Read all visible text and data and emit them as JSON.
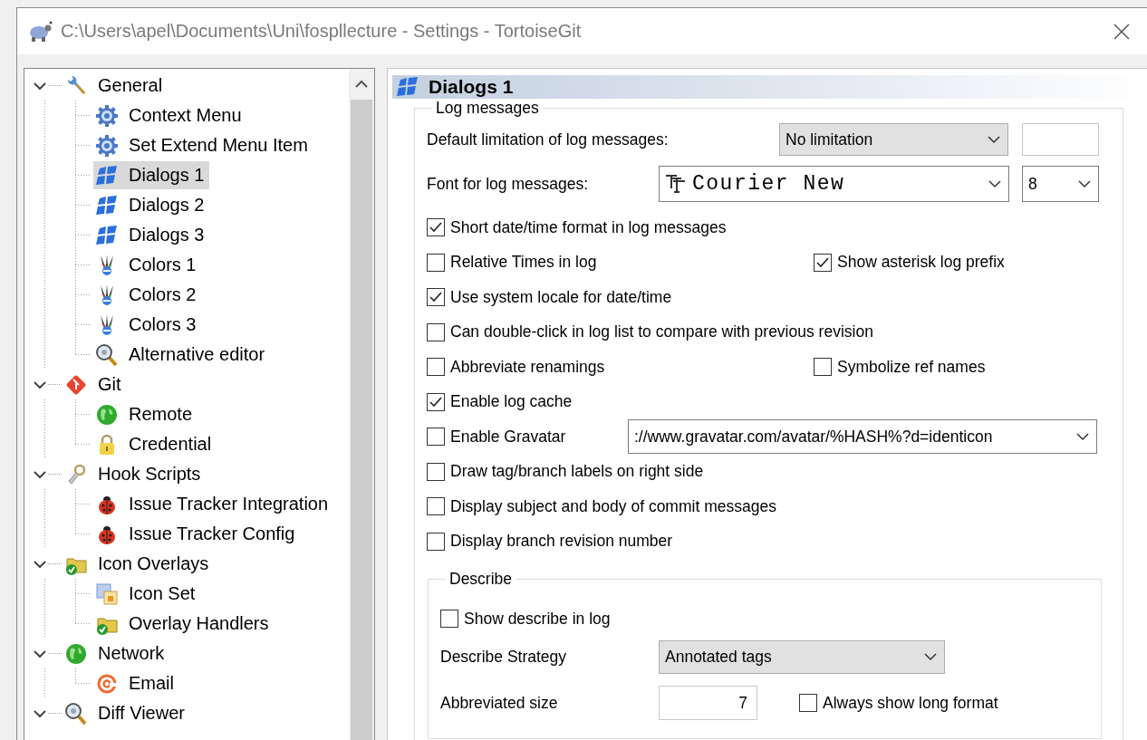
{
  "window": {
    "title": "C:\\Users\\apel\\Documents\\Uni\\fospllecture - Settings - TortoiseGit"
  },
  "tree": [
    {
      "label": "General",
      "kind": "wrench",
      "expanded": true,
      "selected": false,
      "children": [
        {
          "label": "Context Menu",
          "kind": "gear",
          "selected": false
        },
        {
          "label": "Set Extend Menu Item",
          "kind": "gear",
          "selected": false
        },
        {
          "label": "Dialogs 1",
          "kind": "flag",
          "selected": true
        },
        {
          "label": "Dialogs 2",
          "kind": "flag",
          "selected": false
        },
        {
          "label": "Dialogs 3",
          "kind": "flag",
          "selected": false
        },
        {
          "label": "Colors 1",
          "kind": "colors",
          "selected": false
        },
        {
          "label": "Colors 2",
          "kind": "colors",
          "selected": false
        },
        {
          "label": "Colors 3",
          "kind": "colors",
          "selected": false
        },
        {
          "label": "Alternative editor",
          "kind": "magnifier",
          "selected": false
        }
      ]
    },
    {
      "label": "Git",
      "kind": "git",
      "expanded": true,
      "selected": false,
      "children": [
        {
          "label": "Remote",
          "kind": "globe",
          "selected": false
        },
        {
          "label": "Credential",
          "kind": "lock",
          "selected": false
        }
      ]
    },
    {
      "label": "Hook Scripts",
      "kind": "hook",
      "expanded": true,
      "selected": false,
      "children": [
        {
          "label": "Issue Tracker Integration",
          "kind": "bug",
          "selected": false
        },
        {
          "label": "Issue Tracker Config",
          "kind": "bug",
          "selected": false
        }
      ]
    },
    {
      "label": "Icon Overlays",
      "kind": "folder",
      "expanded": true,
      "selected": false,
      "children": [
        {
          "label": "Icon Set",
          "kind": "iconset",
          "selected": false
        },
        {
          "label": "Overlay Handlers",
          "kind": "folder",
          "selected": false
        }
      ]
    },
    {
      "label": "Network",
      "kind": "globe",
      "expanded": true,
      "selected": false,
      "children": [
        {
          "label": "Email",
          "kind": "at",
          "selected": false
        }
      ]
    },
    {
      "label": "Diff Viewer",
      "kind": "magnifier",
      "expanded": true,
      "selected": false
    }
  ],
  "page": {
    "title": "Dialogs 1"
  },
  "log_messages": {
    "legend": "Log messages",
    "limit_label": "Default limitation of log messages:",
    "limit_value": "No limitation",
    "font_label": "Font for log messages:",
    "font_value": "Courier New",
    "font_size": "8",
    "options": [
      {
        "kind": "single",
        "label": "Short date/time format in log messages",
        "checked": true
      },
      {
        "kind": "pair",
        "label": "Relative Times in log",
        "checked": false,
        "right": {
          "label": "Show asterisk log prefix",
          "checked": true
        }
      },
      {
        "kind": "single",
        "label": "Use system locale for date/time",
        "checked": true
      },
      {
        "kind": "single",
        "label": "Can double-click in log list to compare with previous revision",
        "checked": false
      },
      {
        "kind": "pair",
        "label": "Abbreviate renamings",
        "checked": false,
        "right": {
          "label": "Symbolize ref names",
          "checked": false
        }
      },
      {
        "kind": "single",
        "label": "Enable log cache",
        "checked": true
      },
      {
        "kind": "dropdown",
        "label": "Enable Gravatar",
        "checked": false,
        "value": "://www.gravatar.com/avatar/%HASH%?d=identicon"
      },
      {
        "kind": "single",
        "label": "Draw tag/branch labels on right side",
        "checked": false
      },
      {
        "kind": "single",
        "label": "Display subject and body of commit messages",
        "checked": false
      },
      {
        "kind": "single",
        "label": "Display branch revision number",
        "checked": false
      }
    ],
    "describe": {
      "legend": "Describe",
      "show": {
        "label": "Show describe in log",
        "checked": false
      },
      "strategy_label": "Describe Strategy",
      "strategy_value": "Annotated tags",
      "size_label": "Abbreviated size",
      "size_value": "7",
      "long": {
        "label": "Always show long format",
        "checked": false
      }
    }
  }
}
